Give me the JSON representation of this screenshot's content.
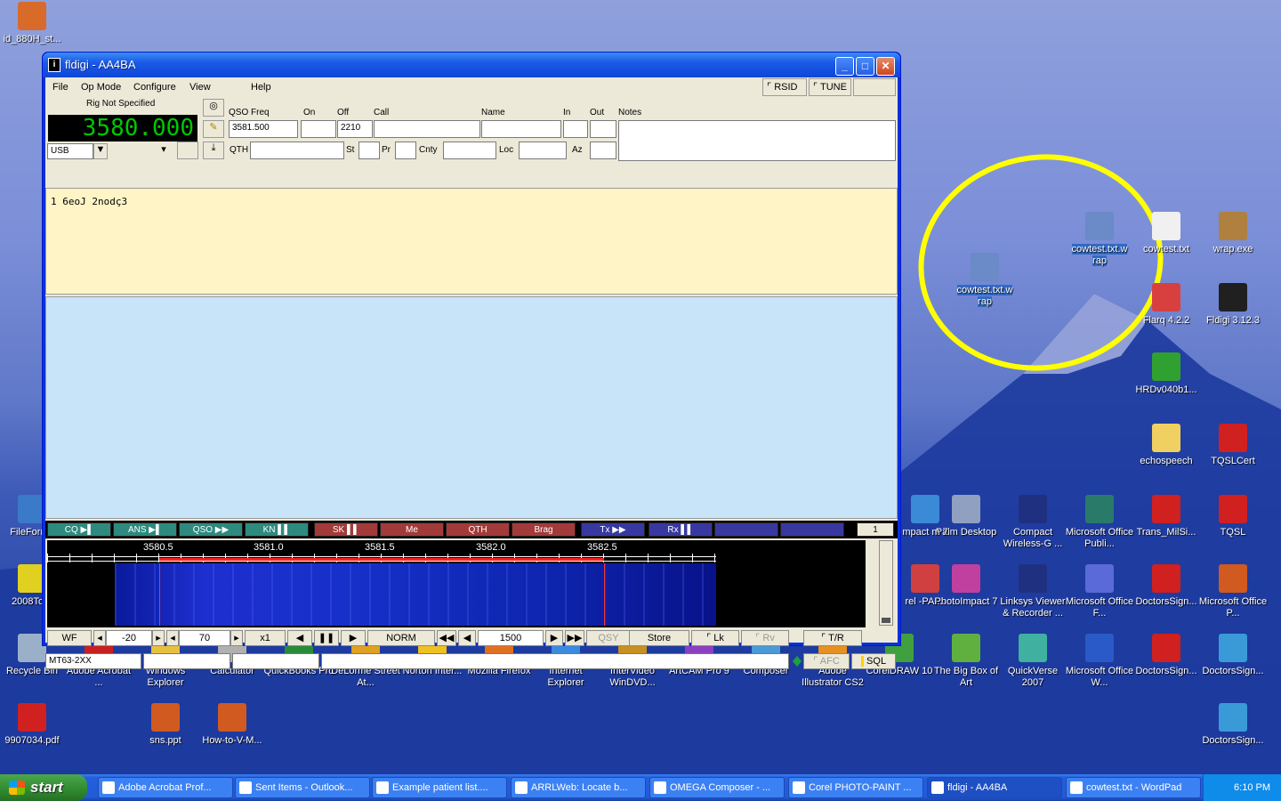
{
  "window": {
    "title": "fldigi - AA4BA",
    "menu": [
      "File",
      "Op Mode",
      "Configure",
      "View",
      "Help"
    ],
    "rsid_label": "RSID",
    "tune_label": "TUNE",
    "rig_label": "Rig Not Specified",
    "frequency": "3580.000",
    "mode": "USB",
    "qso": {
      "qso_freq_label": "QSO Freq",
      "qso_freq_value": "3581.500",
      "on_label": "On",
      "off_label": "Off",
      "off_value": "2210",
      "call_label": "Call",
      "name_label": "Name",
      "in_label": "In",
      "out_label": "Out",
      "notes_label": "Notes",
      "qth_label": "QTH",
      "st_label": "St",
      "pr_label": "Pr",
      "cnty_label": "Cnty",
      "loc_label": "Loc",
      "az_label": "Az"
    },
    "rx_text": "1  6eoJ  2nodç3",
    "macros": [
      {
        "label": "CQ ▶▌",
        "color": "#2e8a7e"
      },
      {
        "label": "ANS ▶▌",
        "color": "#2e8a7e"
      },
      {
        "label": "QSO ▶▶",
        "color": "#2e8a7e"
      },
      {
        "label": "KN ▌▌",
        "color": "#2e8a7e"
      },
      {
        "label": "SK ▌▌",
        "color": "#a33a3a"
      },
      {
        "label": "Me",
        "color": "#a33a3a"
      },
      {
        "label": "QTH",
        "color": "#a33a3a"
      },
      {
        "label": "Brag",
        "color": "#a33a3a"
      },
      {
        "label": "Tx ▶▶",
        "color": "#3838a0"
      },
      {
        "label": "Rx ▌▌",
        "color": "#3838a0"
      },
      {
        "label": "",
        "color": "#3838a0"
      },
      {
        "label": "",
        "color": "#3838a0"
      }
    ],
    "macro_page": "1",
    "waterfall_ticks": [
      "3580.5",
      "3581.0",
      "3581.5",
      "3582.0",
      "3582.5"
    ],
    "controls": {
      "wf": "WF",
      "level1": "-20",
      "level2": "70",
      "zoom": "x1",
      "norm": "NORM",
      "carrier": "1500",
      "qsy": "QSY",
      "store": "Store",
      "lk": "Lk",
      "rv": "Rv",
      "tr": "T/R"
    },
    "status": {
      "mode": "MT63-2XX",
      "afc": "AFC",
      "sql": "SQL"
    }
  },
  "desktop_icons": [
    {
      "label": "id_880H_st...",
      "color": "#d86a2a"
    },
    {
      "label": "FileForma",
      "color": "#3a7ac8"
    },
    {
      "label": "2008Tour",
      "color": "#e0d020"
    },
    {
      "label": "Recycle Bin",
      "color": "#9ab0c8"
    },
    {
      "label": "9907034.pdf",
      "color": "#d02020"
    },
    {
      "label": "Adobe Acrobat ...",
      "color": "#c82020"
    },
    {
      "label": "Windows Explorer",
      "color": "#e8c040"
    },
    {
      "label": "Calculator",
      "color": "#b0b0b0"
    },
    {
      "label": "QuickBooks Pro",
      "color": "#2a8a3a"
    },
    {
      "label": "DeLorme Street At...",
      "color": "#e0a020"
    },
    {
      "label": "Norton Inter...",
      "color": "#f0c020"
    },
    {
      "label": "Mozilla Firefox",
      "color": "#e07020"
    },
    {
      "label": "Internet Explorer",
      "color": "#3a8ae0"
    },
    {
      "label": "InterVideo WinDVD...",
      "color": "#c89020"
    },
    {
      "label": "ArtCAM Pro 9",
      "color": "#8a40c0"
    },
    {
      "label": "Composer",
      "color": "#4a9ad8"
    },
    {
      "label": "Adobe Illustrator CS2",
      "color": "#e89020"
    },
    {
      "label": "CorelDRAW 10",
      "color": "#40a040"
    },
    {
      "label": "The Big Box of Art",
      "color": "#60b040"
    },
    {
      "label": "QuickVerse 2007",
      "color": "#40b0a0"
    },
    {
      "label": "Microsoft Office W...",
      "color": "#2a5ac8"
    },
    {
      "label": "DoctorsSign...",
      "color": "#d02020"
    },
    {
      "label": "DoctorsSign...",
      "color": "#3a9ad8"
    },
    {
      "label": "sns.ppt",
      "color": "#d05a20"
    },
    {
      "label": "How-to-V-M...",
      "color": "#d05a20"
    },
    {
      "label": "cowtest.txt.w rap",
      "color": "#6a8ac8"
    },
    {
      "label": "cowtest.txt.w rap",
      "color": "#6a8ac8"
    },
    {
      "label": "cowtest.txt",
      "color": "#f0f0f0"
    },
    {
      "label": "wrap.exe",
      "color": "#b08040"
    },
    {
      "label": "Flarq 4.2.2",
      "color": "#d84040"
    },
    {
      "label": "Fldigi 3.12.3",
      "color": "#202020"
    },
    {
      "label": "HRDv040b1...",
      "color": "#30a030"
    },
    {
      "label": "echospeech",
      "color": "#f0d060"
    },
    {
      "label": "TQSLCert",
      "color": "#d02020"
    },
    {
      "label": "Palm Desktop",
      "color": "#90a0c0"
    },
    {
      "label": "Compact Wireless-G ...",
      "color": "#203080"
    },
    {
      "label": "Microsoft Office Publi...",
      "color": "#2a7a6a"
    },
    {
      "label": "Trans_MilSi...",
      "color": "#d02020"
    },
    {
      "label": "TQSL",
      "color": "#d02020"
    },
    {
      "label": "PhotoImpact 7",
      "color": "#c040a0"
    },
    {
      "label": "Linksys Viewer & Recorder ...",
      "color": "#203080"
    },
    {
      "label": "Microsoft Office F...",
      "color": "#5a6ad8"
    },
    {
      "label": "DoctorsSign...",
      "color": "#d02020"
    },
    {
      "label": "Microsoft Office P...",
      "color": "#d05a20"
    },
    {
      "label": "DoctorsSign...",
      "color": "#3a9ad8"
    },
    {
      "label": "mpact m 7",
      "color": "#3a8ad8"
    },
    {
      "label": "rel -PAI...",
      "color": "#d04040"
    }
  ],
  "taskbar": {
    "start": "start",
    "tasks": [
      "Adobe Acrobat Prof...",
      "Sent Items - Outlook...",
      "Example patient list....",
      "ARRLWeb: Locate b...",
      "OMEGA Composer - ...",
      "Corel PHOTO-PAINT ...",
      "fldigi - AA4BA",
      "cowtest.txt - WordPad"
    ],
    "clock": "6:10 PM"
  }
}
